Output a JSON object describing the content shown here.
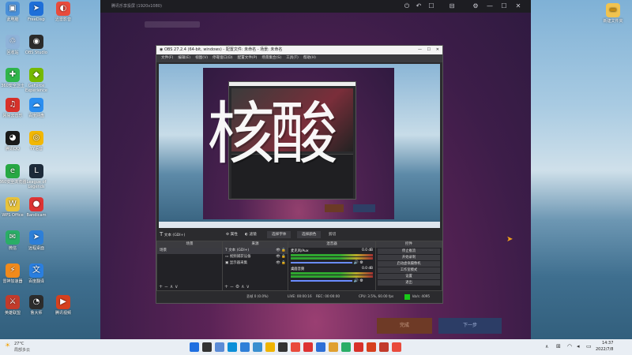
{
  "desktop_left": [
    {
      "label": "此电脑",
      "color": "#4a90d9",
      "glyph": "▣"
    },
    {
      "label": "FreeDisp",
      "color": "#1e6fd9",
      "glyph": "➤"
    },
    {
      "label": "迅雷影音",
      "color": "#e94b3c",
      "glyph": "◐"
    },
    {
      "label": "回收站",
      "color": "#8fb3d9",
      "glyph": "♲"
    },
    {
      "label": "OBS Studio",
      "color": "#2b2b2b",
      "glyph": "◉"
    },
    {
      "label": "360安全卫士",
      "color": "#2fb54a",
      "glyph": "✚"
    },
    {
      "label": "GeForce Experience",
      "color": "#76b900",
      "glyph": "◆"
    },
    {
      "label": "网易云音乐",
      "color": "#d8312a",
      "glyph": "♫"
    },
    {
      "label": "百度网盘",
      "color": "#2b8ef0",
      "glyph": "☁"
    },
    {
      "label": "腾讯QQ",
      "color": "#1a1a1a",
      "glyph": "◕"
    },
    {
      "label": "YY语音",
      "color": "#f2b705",
      "glyph": "◎"
    },
    {
      "label": "360安全浏览器",
      "color": "#27a843",
      "glyph": "e"
    },
    {
      "label": "League of Legends",
      "color": "#1d2b3a",
      "glyph": "L"
    },
    {
      "label": "WPS Office",
      "color": "#e8c33b",
      "glyph": "W"
    },
    {
      "label": "Bandicam",
      "color": "#d33",
      "glyph": "●"
    },
    {
      "label": "微信",
      "color": "#2aae67",
      "glyph": "✉"
    },
    {
      "label": "远程桌面",
      "color": "#2d7fd8",
      "glyph": "➤"
    },
    {
      "label": "雷神加速器",
      "color": "#f08a1c",
      "glyph": "⚡"
    },
    {
      "label": "百度翻译",
      "color": "#2a7fe0",
      "glyph": "文"
    },
    {
      "label": "英雄联盟",
      "color": "#c23b2b",
      "glyph": "⚔"
    },
    {
      "label": "鲁大师",
      "color": "#2c2c2c",
      "glyph": "◔"
    },
    {
      "label": "腾讯视频",
      "color": "#d6401e",
      "glyph": "▶"
    }
  ],
  "desktop_right": {
    "label": "新建文件夹",
    "color": "#f1c34f",
    "glyph": "▬"
  },
  "remote_window": {
    "title": "腾讯乐享投屏 (1920x1080)",
    "controls": [
      "⏻",
      "↶",
      "☐",
      "⊟",
      "⚙",
      "—",
      "☐",
      "✕"
    ],
    "footer_buttons": [
      "完成",
      "下一步"
    ]
  },
  "obs": {
    "title": "OBS 27.2.4 (64-bit, windows) - 配置文件: 未命名 - 场景: 未命名",
    "menu": [
      "文件(F)",
      "编辑(E)",
      "视图(V)",
      "停靠窗口(D)",
      "配置文件(P)",
      "场景集合(S)",
      "工具(T)",
      "帮助(H)"
    ],
    "toolbar": {
      "text_label": "文本 (GDI+)",
      "props": "属性",
      "filter": "滤镜",
      "select_font": "选择字体",
      "select_color": "选择颜色",
      "cut": "剪切"
    },
    "scenes": {
      "header": "场景",
      "items": [
        "场景"
      ]
    },
    "sources": {
      "header": "来源",
      "items": [
        "文本 (GDI+)",
        "视频捕获设备",
        "显示器采集"
      ]
    },
    "mixer": {
      "header": "混音器",
      "tracks": [
        {
          "name": "麦克风/Aux",
          "db": "0.0 dB"
        },
        {
          "name": "桌面音频",
          "db": "0.0 dB"
        }
      ]
    },
    "controls": {
      "header": "控件",
      "buttons": [
        "停止推流",
        "开始录制",
        "启动虚拟摄像机",
        "工作室模式",
        "设置",
        "退出"
      ]
    },
    "status": {
      "drop": "丢帧 0 (0.0%)",
      "live": "LIVE: 00:00:16",
      "rec": "REC: 00:00:00",
      "cpu": "CPU: 3.5%, 60.00 fps",
      "kbps": "kb/s: 4095"
    }
  },
  "overlay_text": "核酸",
  "taskbar": {
    "weather": "27°C",
    "weather_sub": "局部多云",
    "time": "14:37",
    "date": "2022/7/8"
  }
}
